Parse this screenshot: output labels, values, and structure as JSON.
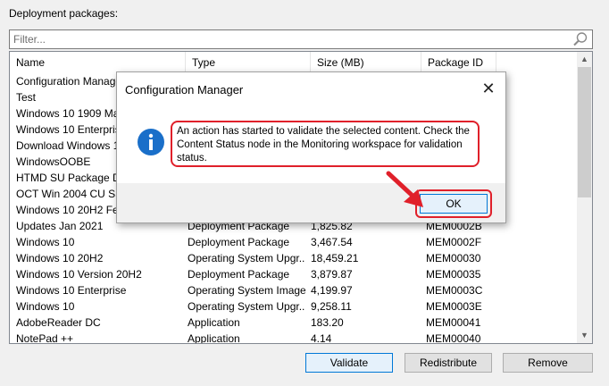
{
  "panel": {
    "label": "Deployment packages:",
    "filter_placeholder": "Filter..."
  },
  "list": {
    "columns": [
      "Name",
      "Type",
      "Size (MB)",
      "Package ID"
    ],
    "rows": [
      [
        "Configuration Manager",
        "",
        "",
        ""
      ],
      [
        "Test",
        "",
        "",
        ""
      ],
      [
        "Windows 10 1909 Ma",
        "",
        "",
        ""
      ],
      [
        "Windows 10 Enterprise",
        "",
        "",
        ""
      ],
      [
        "Download Windows 1",
        "",
        "",
        ""
      ],
      [
        "WindowsOOBE",
        "",
        "",
        ""
      ],
      [
        "HTMD SU Package D",
        "",
        "",
        ""
      ],
      [
        "OCT Win 2004 CU SS",
        "",
        "",
        ""
      ],
      [
        "Windows 10 20H2 Fea",
        "",
        "",
        ""
      ],
      [
        "Updates Jan 2021",
        "Deployment Package",
        "1,825.82",
        "MEM0002B"
      ],
      [
        "Windows 10",
        "Deployment Package",
        "3,467.54",
        "MEM0002F"
      ],
      [
        "Windows 10 20H2",
        "Operating System Upgr...",
        "18,459.21",
        "MEM00030"
      ],
      [
        "Windows 10 Version 20H2",
        "Deployment Package",
        "3,879.87",
        "MEM00035"
      ],
      [
        "Windows 10 Enterprise",
        "Operating System Image",
        "4,199.97",
        "MEM0003C"
      ],
      [
        "Windows 10",
        "Operating System Upgr...",
        "9,258.11",
        "MEM0003E"
      ],
      [
        "AdobeReader DC",
        "Application",
        "183.20",
        "MEM00041"
      ],
      [
        "NotePad ++",
        "Application",
        "4.14",
        "MEM00040"
      ]
    ]
  },
  "buttons": {
    "validate": "Validate",
    "redistribute": "Redistribute",
    "remove": "Remove"
  },
  "dialog": {
    "title": "Configuration Manager",
    "close": "✕",
    "message": "An action has started to validate the selected content. Check the Content Status node in the Monitoring workspace for validation status.",
    "ok": "OK"
  },
  "colors": {
    "highlight": "#e0202a",
    "accent": "#0078d7",
    "info": "#1a6fc9"
  }
}
